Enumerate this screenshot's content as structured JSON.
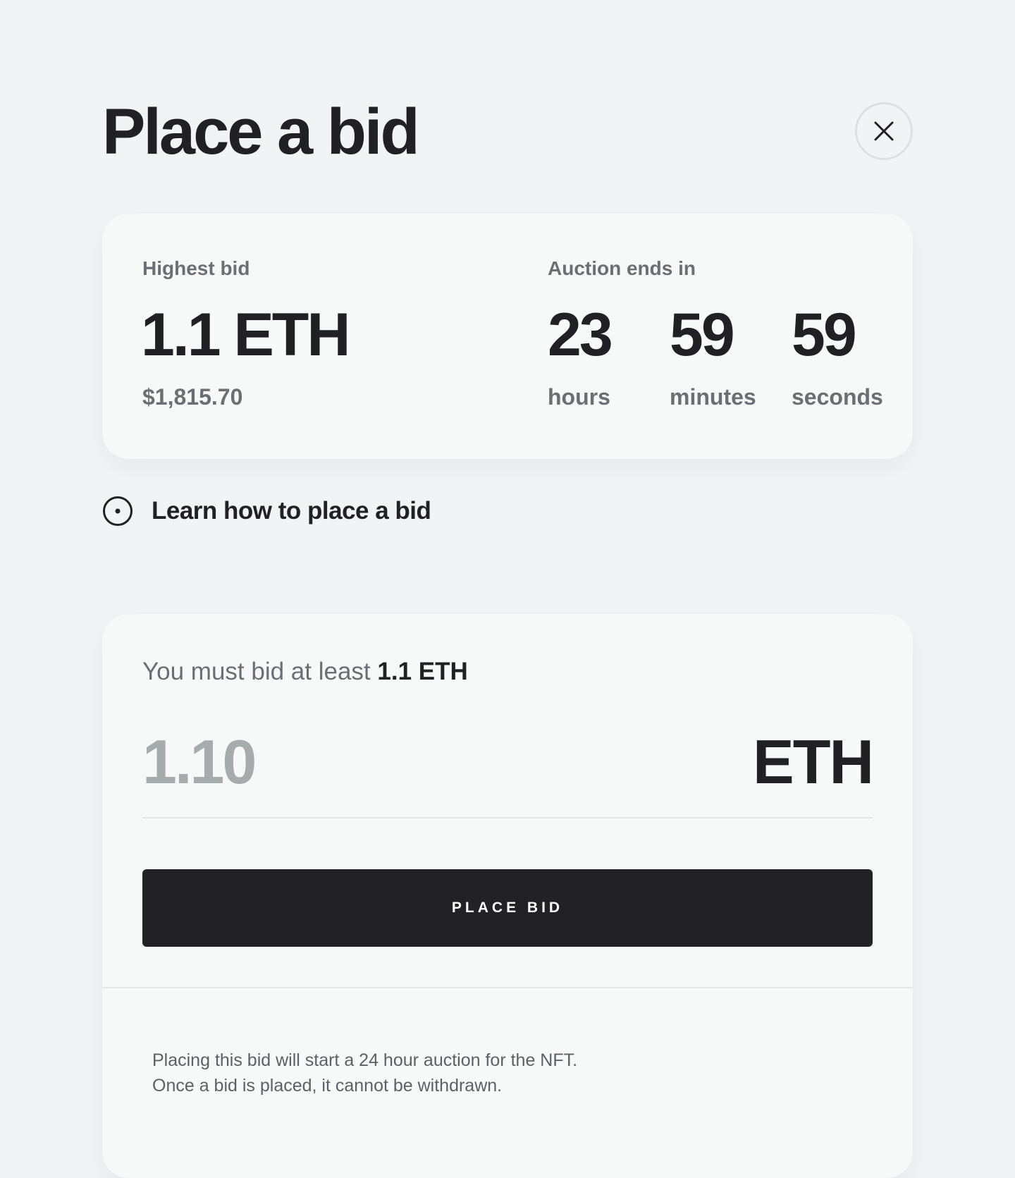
{
  "header": {
    "title": "Place a bid",
    "close_icon": "close-icon"
  },
  "stats": {
    "highest_bid_label": "Highest bid",
    "highest_bid_value": "1.1 ETH",
    "highest_bid_usd": "$1,815.70",
    "auction_label": "Auction ends in",
    "countdown": [
      {
        "value": "23",
        "unit": "hours"
      },
      {
        "value": "59",
        "unit": "minutes"
      },
      {
        "value": "59",
        "unit": "seconds"
      }
    ]
  },
  "learn": {
    "icon": "play-circle-icon",
    "label": "Learn how to place a bid"
  },
  "bid_form": {
    "min_bid_prefix": "You must bid at least",
    "min_bid_amount": "1.1 ETH",
    "amount_placeholder": "1.10",
    "currency": "ETH",
    "submit_label": "PLACE BID"
  },
  "disclaimer": {
    "line1": "Placing this bid will start a 24 hour auction for the NFT.",
    "line2": "Once a bid is placed, it cannot be withdrawn."
  }
}
